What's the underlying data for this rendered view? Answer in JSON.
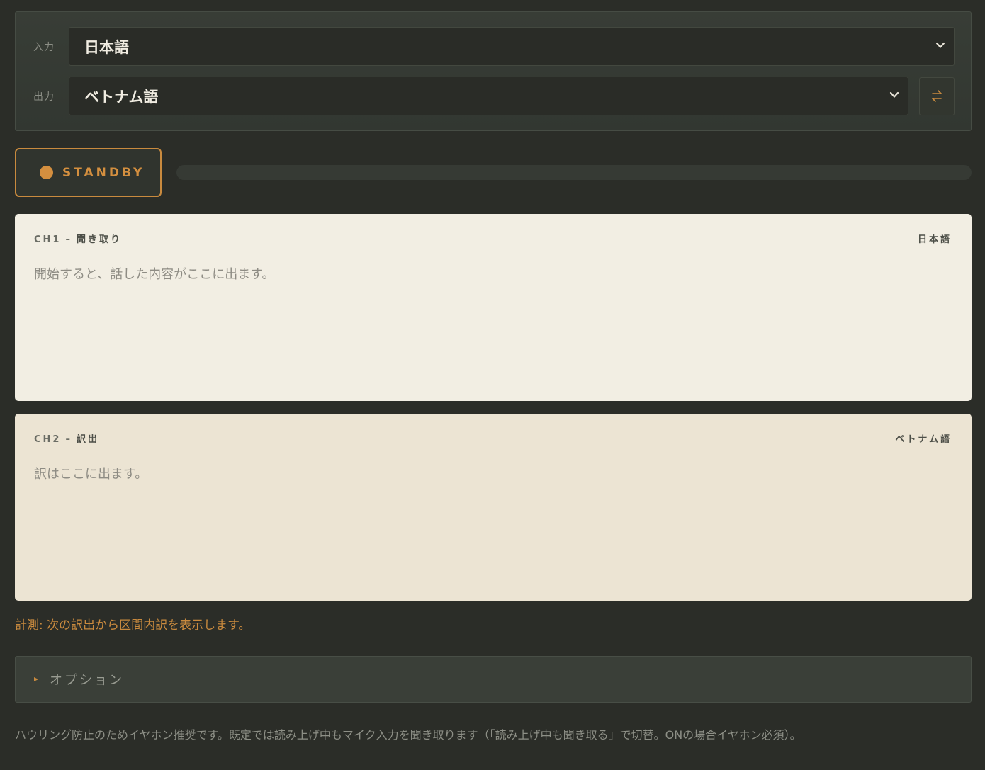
{
  "languages": {
    "input_label": "入力",
    "input_value": "日本語",
    "output_label": "出力",
    "output_value": "ベトナム語"
  },
  "status": {
    "label": "STANDBY",
    "accent": "#d48f3f",
    "level": 0
  },
  "channels": [
    {
      "code": "CH1",
      "title": "聞き取り",
      "lang": "日本語",
      "placeholder": "開始すると、話した内容がここに出ます。"
    },
    {
      "code": "CH2",
      "title": "訳出",
      "lang": "ベトナム語",
      "placeholder": "訳はここに出ます。"
    }
  ],
  "metric_note": "計測: 次の訳出から区間内訳を表示します。",
  "options_label": "オプション",
  "footer_note": "ハウリング防止のためイヤホン推奨です。既定では読み上げ中もマイク入力を聞き取ります（「読み上げ中も聞き取る」で切替。ONの場合イヤホン必須）。",
  "icons": {
    "select_chevron": "chevron-down-icon",
    "swap": "swap-icon",
    "options_toggle": "triangle-right-icon"
  }
}
